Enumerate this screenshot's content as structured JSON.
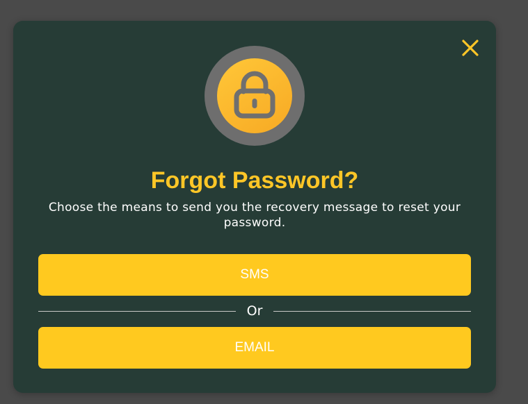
{
  "dialog": {
    "title": "Forgot Password?",
    "subtitle": "Choose the means to send you the recovery message to reset your password.",
    "close_icon": "close-icon",
    "lock_icon": "lock-icon",
    "sms_label": "SMS",
    "divider_label": "Or",
    "email_label": "EMAIL"
  },
  "colors": {
    "page_background": "#4a4a4a",
    "dialog_background": "#263c36",
    "accent": "#ffc627",
    "button_background": "#ffc91f",
    "lock_ring": "#6e6e6e",
    "text": "#ffffff"
  }
}
